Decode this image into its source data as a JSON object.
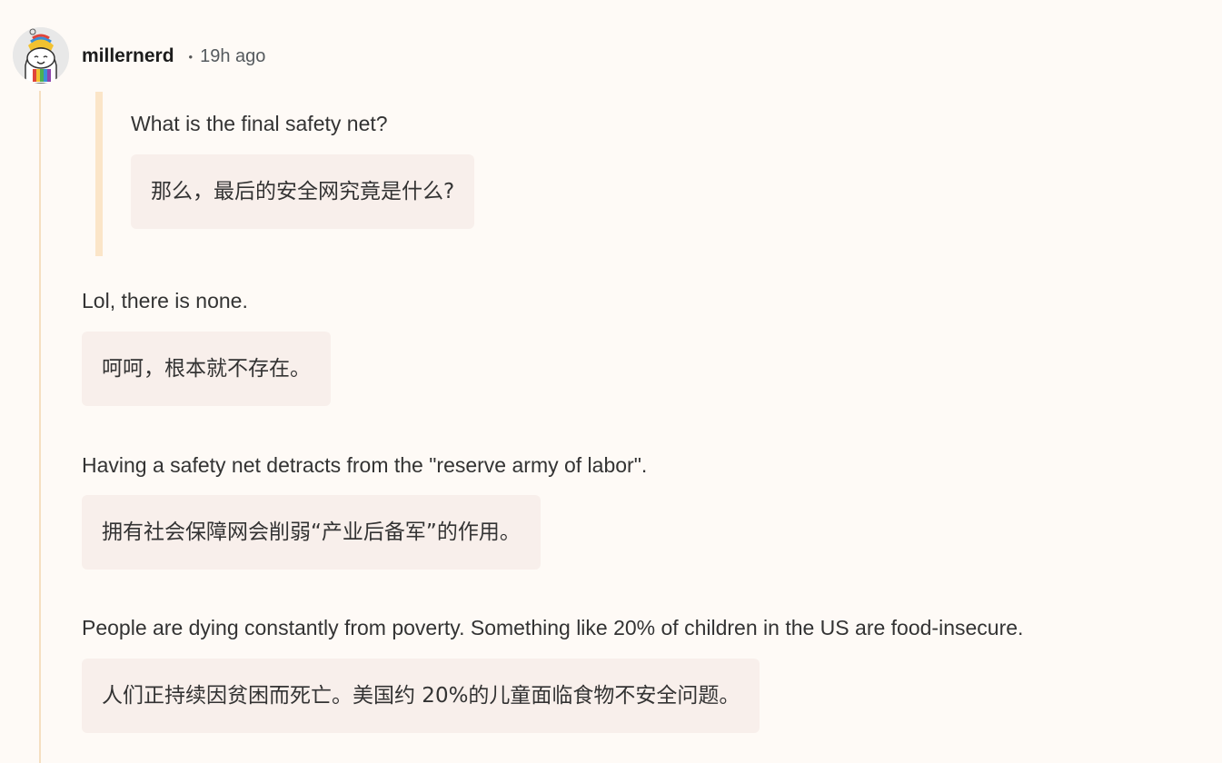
{
  "comment": {
    "username": "millernerd",
    "separator": "•",
    "time_ago": "19h ago",
    "avatar_icon": "snoo-avatar-icon",
    "colors": {
      "quote_bar": "#fbe5c8",
      "thread_line": "#f5dfc0",
      "translation_bg": "#f8efeb",
      "background": "#fefaf6"
    },
    "quote": {
      "text": "What is the final safety net?",
      "translation": "那么，最后的安全网究竟是什么?"
    },
    "paragraphs": [
      {
        "text": "Lol, there is none.",
        "translation": "呵呵，根本就不存在。"
      },
      {
        "text": "Having a safety net detracts from the \"reserve army of labor\".",
        "translation": "拥有社会保障网会削弱“产业后备军”的作用。"
      },
      {
        "text": "People are dying constantly from poverty. Something like 20% of children in the US are food-insecure.",
        "translation": "人们正持续因贫困而死亡。美国约 20%的儿童面临食物不安全问题。"
      }
    ]
  }
}
